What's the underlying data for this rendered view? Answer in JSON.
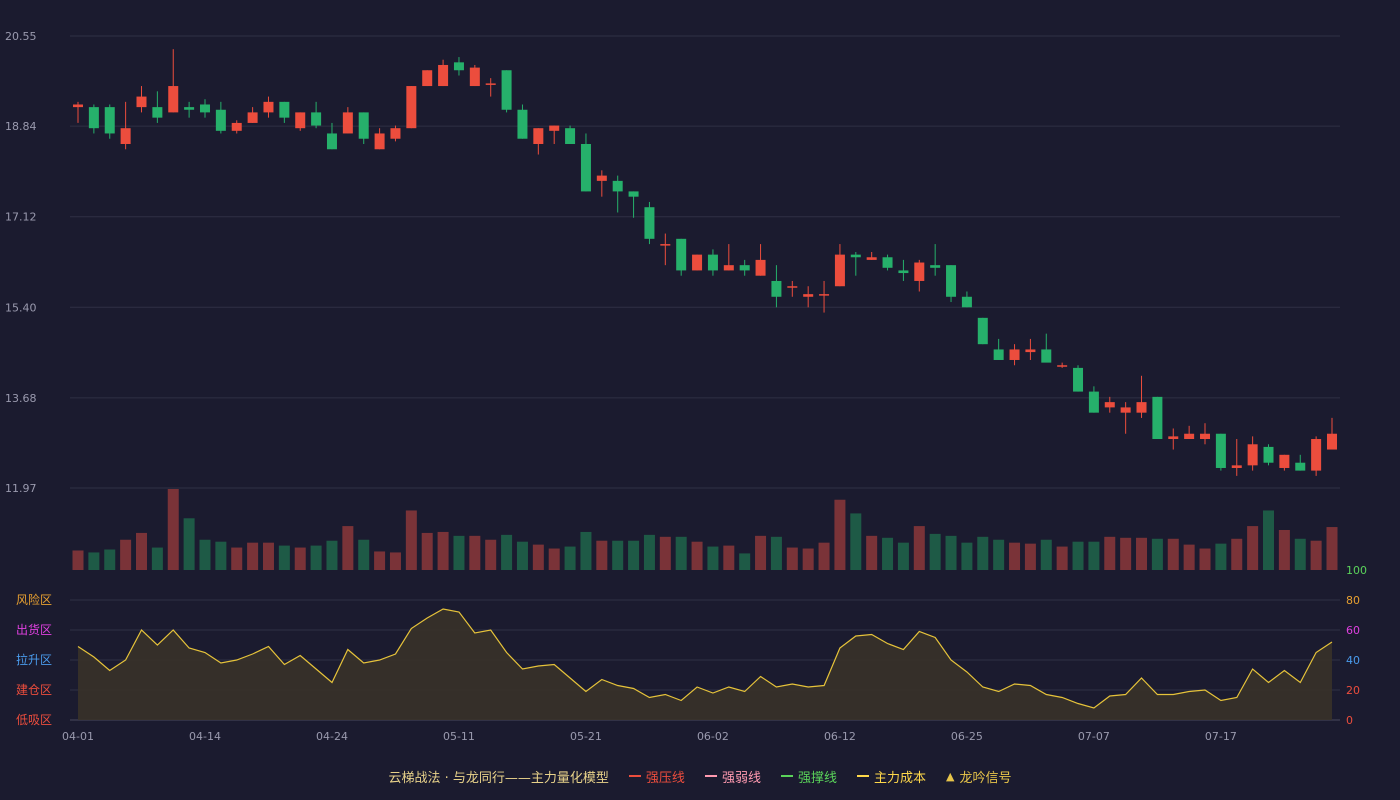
{
  "colors": {
    "background": "#1b1b2f",
    "up": "#ec4d3d",
    "down": "#26b06b",
    "grid": "#2f3045",
    "osc_line": "#e6c33a",
    "osc_fill": "#3a3328",
    "vol_up": "#7a3338",
    "vol_down": "#1e5a46"
  },
  "chart_data": {
    "type": "candlestick",
    "price_axis": {
      "ticks": [
        "20.55",
        "18.84",
        "17.12",
        "15.40",
        "13.68",
        "11.97"
      ],
      "min": 11.97,
      "max": 20.55
    },
    "x_tick_labels": [
      {
        "label": "04-01",
        "index": 0
      },
      {
        "label": "04-14",
        "index": 8
      },
      {
        "label": "04-24",
        "index": 16
      },
      {
        "label": "05-11",
        "index": 24
      },
      {
        "label": "05-21",
        "index": 32
      },
      {
        "label": "06-02",
        "index": 40
      },
      {
        "label": "06-12",
        "index": 48
      },
      {
        "label": "06-25",
        "index": 56
      },
      {
        "label": "07-07",
        "index": 64
      },
      {
        "label": "07-17",
        "index": 72
      }
    ],
    "candles": [
      [
        19.2,
        19.3,
        18.9,
        19.25
      ],
      [
        19.2,
        19.25,
        18.7,
        18.8
      ],
      [
        19.2,
        19.25,
        18.6,
        18.7
      ],
      [
        18.5,
        19.3,
        18.4,
        18.8
      ],
      [
        19.2,
        19.6,
        19.1,
        19.4
      ],
      [
        19.2,
        19.5,
        18.9,
        19.0
      ],
      [
        19.1,
        20.3,
        19.1,
        19.6
      ],
      [
        19.2,
        19.3,
        19.0,
        19.15
      ],
      [
        19.25,
        19.35,
        19.0,
        19.1
      ],
      [
        19.15,
        19.3,
        18.7,
        18.75
      ],
      [
        18.75,
        18.95,
        18.7,
        18.9
      ],
      [
        18.9,
        19.2,
        18.9,
        19.1
      ],
      [
        19.1,
        19.4,
        19.0,
        19.3
      ],
      [
        19.3,
        19.3,
        18.9,
        19.0
      ],
      [
        18.8,
        19.1,
        18.75,
        19.1
      ],
      [
        19.1,
        19.3,
        18.8,
        18.85
      ],
      [
        18.7,
        18.9,
        18.4,
        18.4
      ],
      [
        18.7,
        19.2,
        18.7,
        19.1
      ],
      [
        19.1,
        19.1,
        18.5,
        18.6
      ],
      [
        18.4,
        18.8,
        18.4,
        18.7
      ],
      [
        18.6,
        18.85,
        18.55,
        18.8
      ],
      [
        18.8,
        19.6,
        18.8,
        19.6
      ],
      [
        19.6,
        19.9,
        19.6,
        19.9
      ],
      [
        19.6,
        20.1,
        19.6,
        20.0
      ],
      [
        20.05,
        20.15,
        19.8,
        19.9
      ],
      [
        19.6,
        20.0,
        19.6,
        19.95
      ],
      [
        19.65,
        19.75,
        19.4,
        19.65
      ],
      [
        19.9,
        19.9,
        19.1,
        19.15
      ],
      [
        19.15,
        19.25,
        18.6,
        18.6
      ],
      [
        18.5,
        18.8,
        18.3,
        18.8
      ],
      [
        18.75,
        18.85,
        18.5,
        18.85
      ],
      [
        18.8,
        18.85,
        18.5,
        18.5
      ],
      [
        18.5,
        18.7,
        17.6,
        17.6
      ],
      [
        17.8,
        18.0,
        17.5,
        17.9
      ],
      [
        17.8,
        17.9,
        17.2,
        17.6
      ],
      [
        17.6,
        17.6,
        17.1,
        17.5
      ],
      [
        17.3,
        17.4,
        16.6,
        16.7
      ],
      [
        16.6,
        16.8,
        16.2,
        16.6
      ],
      [
        16.7,
        16.7,
        16.0,
        16.1
      ],
      [
        16.1,
        16.4,
        16.1,
        16.4
      ],
      [
        16.4,
        16.5,
        16.0,
        16.1
      ],
      [
        16.1,
        16.6,
        16.1,
        16.2
      ],
      [
        16.2,
        16.3,
        16.0,
        16.1
      ],
      [
        16.0,
        16.6,
        16.0,
        16.3
      ],
      [
        15.9,
        16.2,
        15.4,
        15.6
      ],
      [
        15.8,
        15.9,
        15.6,
        15.8
      ],
      [
        15.6,
        15.8,
        15.4,
        15.65
      ],
      [
        15.65,
        15.9,
        15.3,
        15.65
      ],
      [
        15.8,
        16.6,
        15.8,
        16.4
      ],
      [
        16.4,
        16.45,
        16.0,
        16.35
      ],
      [
        16.3,
        16.45,
        16.3,
        16.35
      ],
      [
        16.35,
        16.4,
        16.1,
        16.15
      ],
      [
        16.1,
        16.3,
        15.9,
        16.05
      ],
      [
        15.9,
        16.3,
        15.7,
        16.25
      ],
      [
        16.2,
        16.6,
        16.0,
        16.15
      ],
      [
        16.2,
        16.2,
        15.5,
        15.6
      ],
      [
        15.6,
        15.7,
        15.4,
        15.4
      ],
      [
        15.2,
        15.2,
        14.7,
        14.7
      ],
      [
        14.6,
        14.8,
        14.4,
        14.4
      ],
      [
        14.4,
        14.7,
        14.3,
        14.6
      ],
      [
        14.55,
        14.8,
        14.4,
        14.6
      ],
      [
        14.6,
        14.9,
        14.4,
        14.35
      ],
      [
        14.3,
        14.35,
        14.25,
        14.3
      ],
      [
        14.25,
        14.3,
        13.8,
        13.8
      ],
      [
        13.8,
        13.9,
        13.4,
        13.4
      ],
      [
        13.5,
        13.7,
        13.4,
        13.6
      ],
      [
        13.4,
        13.6,
        13.0,
        13.5
      ],
      [
        13.4,
        14.1,
        13.3,
        13.6
      ],
      [
        13.7,
        13.7,
        12.9,
        12.9
      ],
      [
        12.9,
        13.1,
        12.7,
        12.95
      ],
      [
        12.9,
        13.15,
        12.9,
        13.0
      ],
      [
        12.9,
        13.2,
        12.8,
        13.0
      ],
      [
        13.0,
        13.0,
        12.3,
        12.35
      ],
      [
        12.35,
        12.9,
        12.2,
        12.4
      ],
      [
        12.4,
        12.95,
        12.3,
        12.8
      ],
      [
        12.75,
        12.8,
        12.4,
        12.45
      ],
      [
        12.35,
        12.6,
        12.3,
        12.6
      ],
      [
        12.45,
        12.6,
        12.3,
        12.3
      ],
      [
        12.3,
        12.95,
        12.2,
        12.9
      ],
      [
        12.7,
        13.3,
        12.7,
        13.0
      ]
    ],
    "volumes": [
      20,
      18,
      21,
      31,
      38,
      23,
      83,
      53,
      31,
      29,
      23,
      28,
      28,
      25,
      23,
      25,
      30,
      45,
      31,
      19,
      18,
      61,
      38,
      39,
      35,
      35,
      31,
      36,
      29,
      26,
      22,
      24,
      39,
      30,
      30,
      30,
      36,
      34,
      34,
      29,
      24,
      25,
      17,
      35,
      34,
      23,
      22,
      28,
      72,
      58,
      35,
      33,
      28,
      45,
      37,
      35,
      28,
      34,
      31,
      28,
      27,
      31,
      24,
      29,
      29,
      34,
      33,
      33,
      32,
      32,
      26,
      22,
      27,
      32,
      45,
      61,
      41,
      32,
      30,
      44,
      40
    ],
    "oscillator": {
      "y_ticks": [
        "0",
        "20",
        "40",
        "60",
        "80",
        "100"
      ],
      "zone_labels": [
        {
          "text": "风险区",
          "value": 80,
          "color": "#e8a030"
        },
        {
          "text": "出货区",
          "value": 60,
          "color": "#e040e0"
        },
        {
          "text": "拉升区",
          "value": 40,
          "color": "#4a9bec"
        },
        {
          "text": "建仓区",
          "value": 20,
          "color": "#ec4d3d"
        },
        {
          "text": "低吸区",
          "value": 0,
          "color": "#ec4d3d"
        }
      ],
      "tick_colors": [
        "#ec4d3d",
        "#ec4d3d",
        "#4a9bec",
        "#e040e0",
        "#e8a030",
        "#5ad35a"
      ],
      "values": [
        49,
        42,
        33,
        40,
        60,
        50,
        60,
        48,
        45,
        38,
        40,
        44,
        49,
        37,
        43,
        34,
        25,
        47,
        38,
        40,
        44,
        61,
        68,
        74,
        72,
        58,
        60,
        45,
        34,
        36,
        37,
        28,
        19,
        27,
        23,
        21,
        15,
        17,
        13,
        22,
        18,
        22,
        19,
        29,
        22,
        24,
        22,
        23,
        48,
        56,
        57,
        51,
        47,
        59,
        55,
        40,
        32,
        22,
        19,
        24,
        23,
        17,
        15,
        11,
        8,
        16,
        17,
        28,
        17,
        17,
        19,
        20,
        13,
        15,
        34,
        25,
        33,
        25,
        45,
        52
      ]
    }
  },
  "legend": {
    "title": "云梯战法 · 与龙同行——主力量化模型",
    "items": [
      {
        "label": "强压线",
        "color": "#ec4d3d",
        "style": "solid"
      },
      {
        "label": "强弱线",
        "color": "#ff9ab0",
        "style": "dash"
      },
      {
        "label": "强撑线",
        "color": "#5ad35a",
        "style": "solid"
      },
      {
        "label": "主力成本",
        "color": "#ffd84a",
        "style": "dash"
      },
      {
        "label": "龙吟信号",
        "color": "#e8c54a",
        "style": "triangle"
      }
    ]
  }
}
